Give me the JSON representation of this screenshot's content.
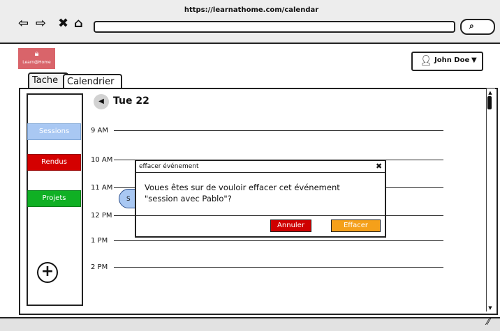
{
  "browser": {
    "url": "https://learnathome.com/calendar",
    "icons": [
      "back-icon",
      "forward-icon",
      "close-icon",
      "home-icon",
      "search-icon"
    ]
  },
  "app": {
    "logo_text": "Learn@Home",
    "user_name": "John Doe"
  },
  "tabs": [
    {
      "label": "Tache"
    },
    {
      "label": "Calendrier",
      "active": true
    }
  ],
  "sidebar": {
    "items": [
      {
        "label": "Sessions",
        "color": "#a9c8f3"
      },
      {
        "label": "Rendus",
        "color": "#d40000"
      },
      {
        "label": "Projets",
        "color": "#10b024"
      }
    ]
  },
  "calendar": {
    "date": "Tue 22",
    "times": [
      "9 AM",
      "10 AM",
      "11 AM",
      "12 PM",
      "1 PM",
      "2 PM"
    ],
    "event_label": "S"
  },
  "modal": {
    "title": "effacer événement",
    "message_line1": "Voues êtes sur de vouloir effacer cet événement",
    "message_line2": "\"session avec Pablo\"?",
    "cancel_label": "Annuler",
    "confirm_label": "Effacer"
  }
}
